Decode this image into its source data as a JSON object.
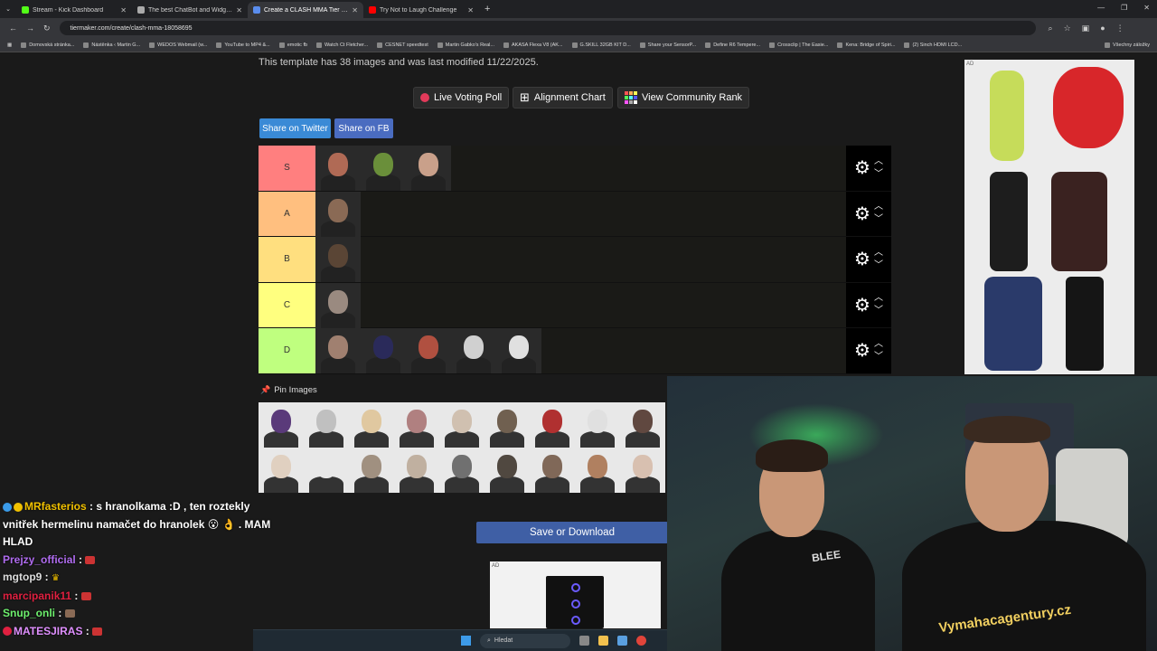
{
  "browser": {
    "tabs": [
      {
        "title": "Stream - Kick Dashboard",
        "color": "#53fc18",
        "active": false
      },
      {
        "title": "The best ChatBot and Widgets",
        "color": "#aaaaaa",
        "active": false
      },
      {
        "title": "Create a CLASH MMA Tier List",
        "color": "#5a8dee",
        "active": true
      },
      {
        "title": "Try Not to Laugh Challenge",
        "color": "#ff0000",
        "active": false
      }
    ],
    "url": "tiermaker.com/create/clash-mma-18058695",
    "bookmarks": [
      "Domovská stránka...",
      "Nástěnka ‹ Martin G...",
      "WEDOS Webmail (w...",
      "YouTube to MP4 &...",
      "emotic fb",
      "Watch Ct Fletcher...",
      "CESNET speedtest",
      "Martin Gabko's Real...",
      "AKASA Flexa V8 (AK...",
      "G.SKILL 32GB KIT D...",
      "Share your SensorP...",
      "Define R6 Tempere...",
      "Crossclip | The Easie...",
      "Kena: Bridge of Spiri...",
      "(2) Sinch HDMI LCD..."
    ],
    "all_bookmarks": "Všechny záložky"
  },
  "page": {
    "template_info": "This template has 38 images and was last modified 11/22/2025.",
    "buttons": {
      "live_voting": "Live Voting Poll",
      "alignment": "Alignment Chart",
      "community": "View Community Rank"
    },
    "share_twitter": "Share on Twitter",
    "share_fb": "Share on FB",
    "tiers": [
      {
        "label": "S",
        "color": "#ff7f7f",
        "items": [
          "#b06a55",
          "#6a8f3a",
          "#c9a08a"
        ]
      },
      {
        "label": "A",
        "color": "#ffbf7f",
        "items": [
          "#8a6a55"
        ]
      },
      {
        "label": "B",
        "color": "#ffdf7f",
        "items": [
          "#5a4535"
        ]
      },
      {
        "label": "C",
        "color": "#ffff7f",
        "items": [
          "#9a8a80"
        ]
      },
      {
        "label": "D",
        "color": "#bfff7f",
        "items": [
          "#a08070",
          "#2a2a5a",
          "#b05040",
          "#d0d0d0",
          "#e0e0e0"
        ]
      }
    ],
    "pin_images": "Pin Images",
    "pool": [
      "#5a3a7a",
      "#c0c0c0",
      "#e0c8a0",
      "#b08080",
      "#d0c0b0",
      "#706050",
      "#b03030",
      "#e0e0e0",
      "#604840",
      "#e0d0c0",
      "#e8e8e8",
      "#a09080",
      "#c0b0a0",
      "#707070",
      "#504840",
      "#806858",
      "#b08060",
      "#d8c0b0"
    ],
    "save_download": "Save or Download",
    "ad_label": "AD"
  },
  "chat": [
    {
      "user": "MRfasterios",
      "user_color": "#f0c000",
      "text": "s hranolkama :D , ten roztekly"
    },
    {
      "user": "",
      "user_color": "#ffffff",
      "text": "vnitřek hermelinu namačet do hranolek"
    },
    {
      "user": "",
      "user_color": "#ffffff",
      "text": ". MAM"
    },
    {
      "user": "",
      "user_color": "#ffffff",
      "text": "HLAD"
    },
    {
      "user": "Prejzy_official",
      "user_color": "#b06cf0",
      "text": ""
    },
    {
      "user": "mgtop9",
      "user_color": "#dddddd",
      "text": ""
    },
    {
      "user": "marcipanik11",
      "user_color": "#e02040",
      "text": ""
    },
    {
      "user": "Snup_onli",
      "user_color": "#6ef06e",
      "text": ""
    },
    {
      "user": "MATESJIRAS",
      "user_color": "#e090ff",
      "text": ""
    }
  ],
  "cam": {
    "shirt1": "BLEE",
    "shirt2": "Vymahacagentury.cz"
  },
  "taskbar": {
    "search": "Hledat"
  }
}
